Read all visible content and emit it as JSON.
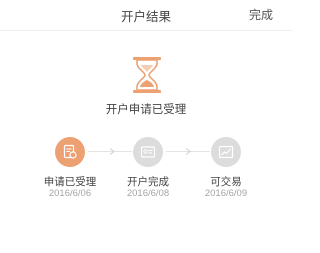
{
  "header": {
    "title": "开户结果",
    "done_label": "完成"
  },
  "status": {
    "icon": "hourglass-icon",
    "text": "开户申请已受理"
  },
  "steps": [
    {
      "label": "申请已受理",
      "date": "2016/6/06",
      "state": "active",
      "icon": "document-stamp-icon"
    },
    {
      "label": "开户完成",
      "date": "2016/6/08",
      "state": "pending",
      "icon": "account-card-icon"
    },
    {
      "label": "可交易",
      "date": "2016/6/09",
      "state": "pending",
      "icon": "trade-chart-icon"
    }
  ],
  "colors": {
    "accent": "#eda173",
    "inactive": "#dcdcdc",
    "date_text": "#a5a5a5"
  }
}
